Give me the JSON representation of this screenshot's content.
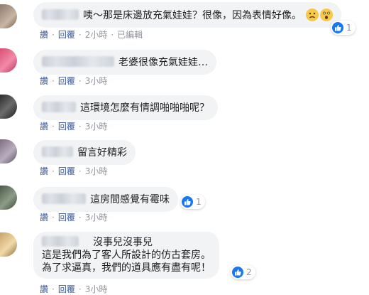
{
  "actions": {
    "like": "讚",
    "reply": "回覆",
    "edited": "已編輯"
  },
  "comments": [
    {
      "text": "咦～那是床邊放充氣娃娃？很像，因為表情好像。",
      "time": "2小時",
      "reactions": "1"
    },
    {
      "text": "老婆很像充氣娃娃…",
      "time": "3小時"
    },
    {
      "text": "這環境怎麼有情調啪啪啪呢？",
      "time": "3小時"
    },
    {
      "text": "留言好精彩",
      "time": "3小時"
    },
    {
      "text": "這房間感覺有霉味",
      "time": "3小時",
      "reactions": "1"
    },
    {
      "lines": [
        "沒事兒沒事兒",
        "這是我們為了客人所設計的仿古套房。",
        "為了求逼真，我們的道具應有盡有呢！"
      ],
      "time": "3小時",
      "reactions": "2"
    }
  ]
}
